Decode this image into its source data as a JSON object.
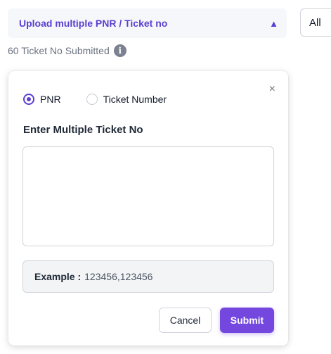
{
  "upload_bar": {
    "label": "Upload multiple PNR / Ticket no",
    "caret": "▲"
  },
  "filter": {
    "selected": "All"
  },
  "submitted_info": {
    "text": "60 Ticket No Submitted",
    "icon_glyph": "i"
  },
  "modal": {
    "close_glyph": "×",
    "radio_options": [
      {
        "label": "PNR",
        "checked": true
      },
      {
        "label": "Ticket Number",
        "checked": false
      }
    ],
    "section_title": "Enter Multiple Ticket No",
    "textarea_value": "",
    "example_label": "Example :",
    "example_value": "123456,123456",
    "cancel_label": "Cancel",
    "submit_label": "Submit"
  },
  "colors": {
    "accent": "#5b3fd0",
    "submit_bg": "#7447df",
    "bar_bg": "#f6f7fb"
  }
}
